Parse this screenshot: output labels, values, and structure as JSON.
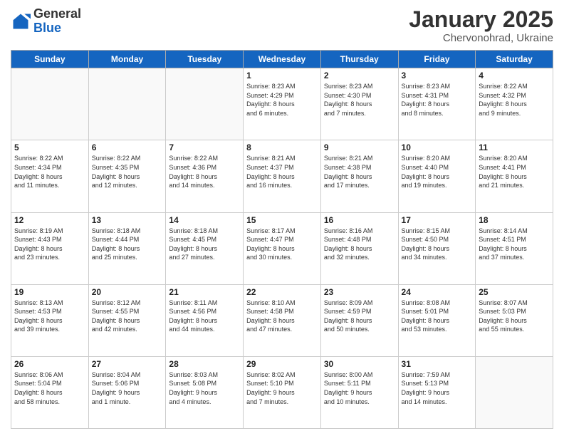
{
  "logo": {
    "general": "General",
    "blue": "Blue"
  },
  "title": {
    "month": "January 2025",
    "location": "Chervonohrad, Ukraine"
  },
  "weekdays": [
    "Sunday",
    "Monday",
    "Tuesday",
    "Wednesday",
    "Thursday",
    "Friday",
    "Saturday"
  ],
  "weeks": [
    [
      {
        "day": "",
        "info": ""
      },
      {
        "day": "",
        "info": ""
      },
      {
        "day": "",
        "info": ""
      },
      {
        "day": "1",
        "info": "Sunrise: 8:23 AM\nSunset: 4:29 PM\nDaylight: 8 hours\nand 6 minutes."
      },
      {
        "day": "2",
        "info": "Sunrise: 8:23 AM\nSunset: 4:30 PM\nDaylight: 8 hours\nand 7 minutes."
      },
      {
        "day": "3",
        "info": "Sunrise: 8:23 AM\nSunset: 4:31 PM\nDaylight: 8 hours\nand 8 minutes."
      },
      {
        "day": "4",
        "info": "Sunrise: 8:22 AM\nSunset: 4:32 PM\nDaylight: 8 hours\nand 9 minutes."
      }
    ],
    [
      {
        "day": "5",
        "info": "Sunrise: 8:22 AM\nSunset: 4:34 PM\nDaylight: 8 hours\nand 11 minutes."
      },
      {
        "day": "6",
        "info": "Sunrise: 8:22 AM\nSunset: 4:35 PM\nDaylight: 8 hours\nand 12 minutes."
      },
      {
        "day": "7",
        "info": "Sunrise: 8:22 AM\nSunset: 4:36 PM\nDaylight: 8 hours\nand 14 minutes."
      },
      {
        "day": "8",
        "info": "Sunrise: 8:21 AM\nSunset: 4:37 PM\nDaylight: 8 hours\nand 16 minutes."
      },
      {
        "day": "9",
        "info": "Sunrise: 8:21 AM\nSunset: 4:38 PM\nDaylight: 8 hours\nand 17 minutes."
      },
      {
        "day": "10",
        "info": "Sunrise: 8:20 AM\nSunset: 4:40 PM\nDaylight: 8 hours\nand 19 minutes."
      },
      {
        "day": "11",
        "info": "Sunrise: 8:20 AM\nSunset: 4:41 PM\nDaylight: 8 hours\nand 21 minutes."
      }
    ],
    [
      {
        "day": "12",
        "info": "Sunrise: 8:19 AM\nSunset: 4:43 PM\nDaylight: 8 hours\nand 23 minutes."
      },
      {
        "day": "13",
        "info": "Sunrise: 8:18 AM\nSunset: 4:44 PM\nDaylight: 8 hours\nand 25 minutes."
      },
      {
        "day": "14",
        "info": "Sunrise: 8:18 AM\nSunset: 4:45 PM\nDaylight: 8 hours\nand 27 minutes."
      },
      {
        "day": "15",
        "info": "Sunrise: 8:17 AM\nSunset: 4:47 PM\nDaylight: 8 hours\nand 30 minutes."
      },
      {
        "day": "16",
        "info": "Sunrise: 8:16 AM\nSunset: 4:48 PM\nDaylight: 8 hours\nand 32 minutes."
      },
      {
        "day": "17",
        "info": "Sunrise: 8:15 AM\nSunset: 4:50 PM\nDaylight: 8 hours\nand 34 minutes."
      },
      {
        "day": "18",
        "info": "Sunrise: 8:14 AM\nSunset: 4:51 PM\nDaylight: 8 hours\nand 37 minutes."
      }
    ],
    [
      {
        "day": "19",
        "info": "Sunrise: 8:13 AM\nSunset: 4:53 PM\nDaylight: 8 hours\nand 39 minutes."
      },
      {
        "day": "20",
        "info": "Sunrise: 8:12 AM\nSunset: 4:55 PM\nDaylight: 8 hours\nand 42 minutes."
      },
      {
        "day": "21",
        "info": "Sunrise: 8:11 AM\nSunset: 4:56 PM\nDaylight: 8 hours\nand 44 minutes."
      },
      {
        "day": "22",
        "info": "Sunrise: 8:10 AM\nSunset: 4:58 PM\nDaylight: 8 hours\nand 47 minutes."
      },
      {
        "day": "23",
        "info": "Sunrise: 8:09 AM\nSunset: 4:59 PM\nDaylight: 8 hours\nand 50 minutes."
      },
      {
        "day": "24",
        "info": "Sunrise: 8:08 AM\nSunset: 5:01 PM\nDaylight: 8 hours\nand 53 minutes."
      },
      {
        "day": "25",
        "info": "Sunrise: 8:07 AM\nSunset: 5:03 PM\nDaylight: 8 hours\nand 55 minutes."
      }
    ],
    [
      {
        "day": "26",
        "info": "Sunrise: 8:06 AM\nSunset: 5:04 PM\nDaylight: 8 hours\nand 58 minutes."
      },
      {
        "day": "27",
        "info": "Sunrise: 8:04 AM\nSunset: 5:06 PM\nDaylight: 9 hours\nand 1 minute."
      },
      {
        "day": "28",
        "info": "Sunrise: 8:03 AM\nSunset: 5:08 PM\nDaylight: 9 hours\nand 4 minutes."
      },
      {
        "day": "29",
        "info": "Sunrise: 8:02 AM\nSunset: 5:10 PM\nDaylight: 9 hours\nand 7 minutes."
      },
      {
        "day": "30",
        "info": "Sunrise: 8:00 AM\nSunset: 5:11 PM\nDaylight: 9 hours\nand 10 minutes."
      },
      {
        "day": "31",
        "info": "Sunrise: 7:59 AM\nSunset: 5:13 PM\nDaylight: 9 hours\nand 14 minutes."
      },
      {
        "day": "",
        "info": ""
      }
    ]
  ]
}
